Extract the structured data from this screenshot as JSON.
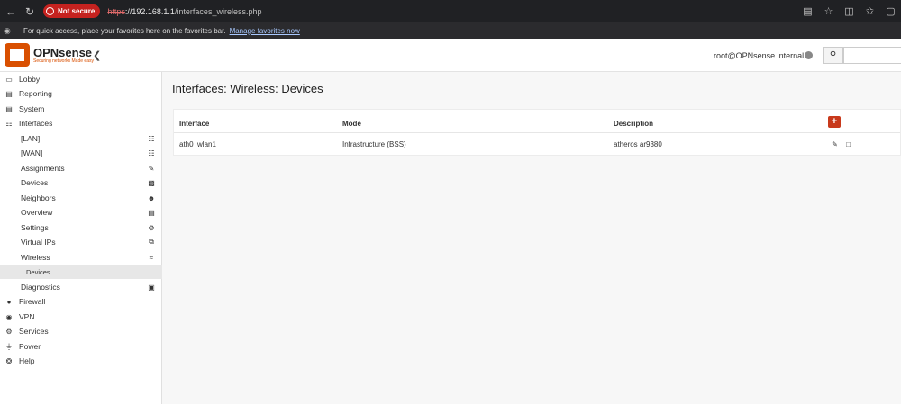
{
  "browser": {
    "warning": "Not secure",
    "url_scheme": "https",
    "url_host": "://192.168.1.1",
    "url_path": "/interfaces_wireless.php",
    "favorites_text": "For quick access, place your favorites here on the favorites bar.",
    "favorites_link": "Manage favorites now"
  },
  "header": {
    "logo_name": "OPNsense",
    "logo_tagline": "Securing networks Made easy",
    "user": "root@OPNsense.internal"
  },
  "sidebar": {
    "items": [
      {
        "label": "Lobby",
        "icon": "laptop-icon"
      },
      {
        "label": "Reporting",
        "icon": "chart-icon"
      },
      {
        "label": "System",
        "icon": "server-icon"
      },
      {
        "label": "Interfaces",
        "icon": "sitemap-icon"
      },
      {
        "label": "[LAN]",
        "icon": "sitemap-icon"
      },
      {
        "label": "[WAN]",
        "icon": "sitemap-icon"
      },
      {
        "label": "Assignments",
        "icon": "pencil-icon"
      },
      {
        "label": "Devices",
        "icon": "archive-icon"
      },
      {
        "label": "Neighbors",
        "icon": "users-icon"
      },
      {
        "label": "Overview",
        "icon": "tasks-icon"
      },
      {
        "label": "Settings",
        "icon": "cogs-icon"
      },
      {
        "label": "Virtual IPs",
        "icon": "clone-icon"
      },
      {
        "label": "Wireless",
        "icon": "wifi-icon"
      },
      {
        "label": "Devices"
      },
      {
        "label": "Diagnostics",
        "icon": "medkit-icon"
      },
      {
        "label": "Firewall",
        "icon": "fire-icon"
      },
      {
        "label": "VPN",
        "icon": "globe-icon"
      },
      {
        "label": "Services",
        "icon": "cog-icon"
      },
      {
        "label": "Power",
        "icon": "plug-icon"
      },
      {
        "label": "Help",
        "icon": "lifebuoy-icon"
      }
    ]
  },
  "main": {
    "title": "Interfaces: Wireless: Devices",
    "table": {
      "headers": [
        "Interface",
        "Mode",
        "Description"
      ],
      "rows": [
        {
          "interface": "ath0_wlan1",
          "mode": "Infrastructure (BSS)",
          "description": "atheros ar9380"
        }
      ]
    }
  },
  "colors": {
    "brand": "#d94f00",
    "add_button": "#c8391b",
    "browser_bar": "#202124"
  }
}
